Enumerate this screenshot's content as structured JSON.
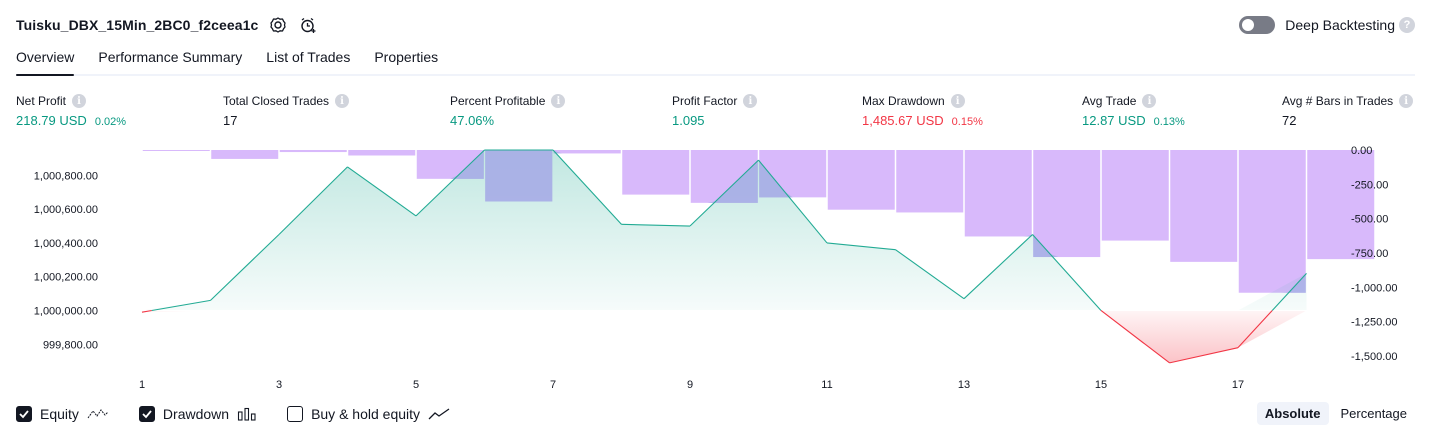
{
  "header": {
    "strategy_name": "Tuisku_DBX_15Min_2BC0_f2ceea1c",
    "deep_backtesting_label": "Deep Backtesting",
    "deep_backtesting_enabled": false
  },
  "tabs": [
    {
      "label": "Overview",
      "active": true
    },
    {
      "label": "Performance Summary",
      "active": false
    },
    {
      "label": "List of Trades",
      "active": false
    },
    {
      "label": "Properties",
      "active": false
    }
  ],
  "stats": [
    {
      "label": "Net Profit",
      "value": "218.79 USD",
      "pct": "0.02%",
      "tone": "pos"
    },
    {
      "label": "Total Closed Trades",
      "value": "17",
      "pct": "",
      "tone": "neutral"
    },
    {
      "label": "Percent Profitable",
      "value": "47.06%",
      "pct": "",
      "tone": "pos"
    },
    {
      "label": "Profit Factor",
      "value": "1.095",
      "pct": "",
      "tone": "pos"
    },
    {
      "label": "Max Drawdown",
      "value": "1,485.67 USD",
      "pct": "0.15%",
      "tone": "neg"
    },
    {
      "label": "Avg Trade",
      "value": "12.87 USD",
      "pct": "0.13%",
      "tone": "pos"
    },
    {
      "label": "Avg # Bars in Trades",
      "value": "72",
      "pct": "",
      "tone": "neutral"
    }
  ],
  "legend": {
    "equity": {
      "label": "Equity",
      "checked": true
    },
    "drawdown": {
      "label": "Drawdown",
      "checked": true
    },
    "buy_hold": {
      "label": "Buy & hold equity",
      "checked": false
    }
  },
  "modes": {
    "absolute": "Absolute",
    "percentage": "Percentage",
    "active": "absolute"
  },
  "colors": {
    "equity_line": "#22ab94",
    "equity_negative": "#f23645",
    "drawdown_bar": "#d8b9fb",
    "overlap": "#a9b2e6"
  },
  "chart_data": {
    "type": "area",
    "x_ticks": [
      "1",
      "3",
      "5",
      "7",
      "9",
      "11",
      "13",
      "15",
      "17"
    ],
    "equity": {
      "x": [
        1,
        2,
        3,
        4,
        5,
        6,
        7,
        8,
        9,
        10,
        11,
        12,
        13,
        14,
        15,
        16,
        17,
        18
      ],
      "y": [
        999990,
        1000060,
        1000450,
        1000850,
        1000560,
        1000950,
        1000950,
        1000510,
        1000500,
        1000890,
        1000400,
        1000360,
        1000070,
        1000450,
        1000000,
        999690,
        999780,
        1000220
      ]
    },
    "drawdown": {
      "x": [
        1,
        2,
        3,
        4,
        5,
        6,
        7,
        8,
        9,
        10,
        11,
        12,
        13,
        14,
        15,
        16,
        17,
        18
      ],
      "y": [
        -5,
        -65,
        -15,
        -40,
        -210,
        -375,
        -25,
        -325,
        -385,
        -345,
        -435,
        -455,
        -630,
        -780,
        -660,
        -815,
        -1040,
        -795
      ]
    },
    "left_axis": {
      "ticks": [
        "1,000,800.00",
        "1,000,600.00",
        "1,000,400.00",
        "1,000,200.00",
        "1,000,000.00",
        "999,800.00"
      ],
      "ylim": [
        999707,
        1000950
      ]
    },
    "right_axis": {
      "ticks": [
        "0.00",
        "-250.00",
        "-500.00",
        "-750.00",
        "-1,000.00",
        "-1,250.00",
        "-1,500.00"
      ],
      "ylim": [
        -1530,
        0
      ]
    }
  }
}
